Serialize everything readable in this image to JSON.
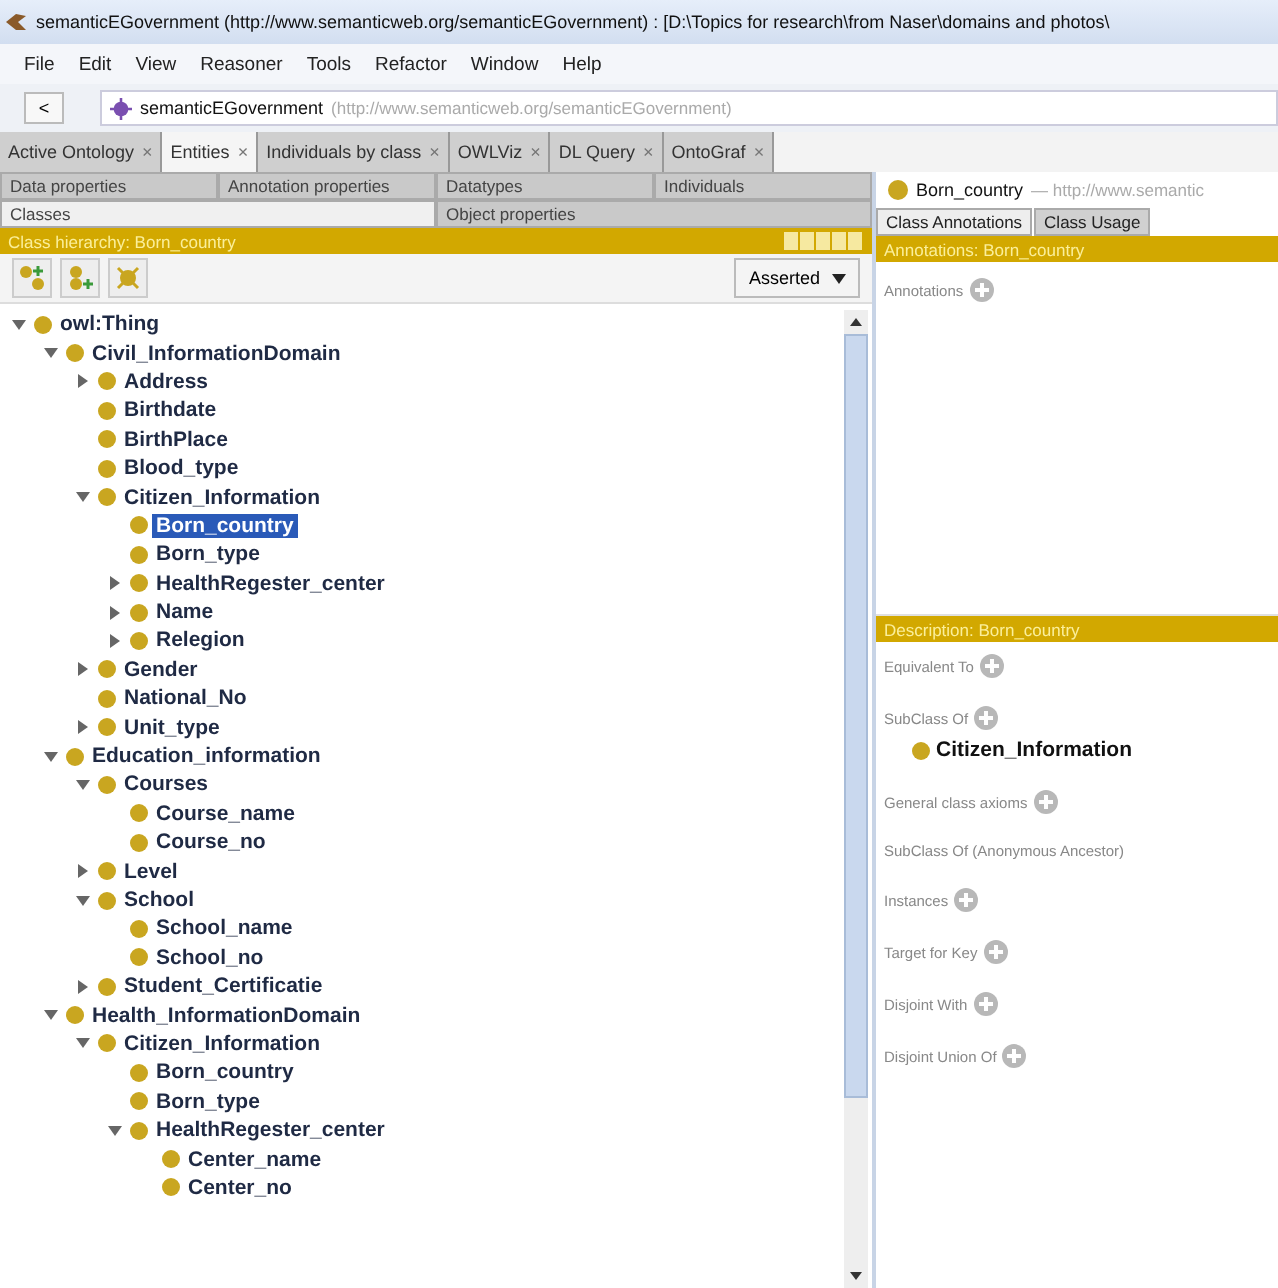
{
  "window": {
    "title": "semanticEGovernment (http://www.semanticweb.org/semanticEGovernment) : [D:\\Topics for research\\from Naser\\domains  and photos\\"
  },
  "menu": [
    "File",
    "Edit",
    "View",
    "Reasoner",
    "Tools",
    "Refactor",
    "Window",
    "Help"
  ],
  "address": {
    "back": "<",
    "name": "semanticEGovernment",
    "iri": "(http://www.semanticweb.org/semanticEGovernment)"
  },
  "tabs": [
    {
      "label": "Active Ontology",
      "close": "×",
      "selected": false
    },
    {
      "label": "Entities",
      "close": "×",
      "selected": true
    },
    {
      "label": "Individuals by class",
      "close": "×",
      "selected": false
    },
    {
      "label": "OWLViz",
      "close": "×",
      "selected": false
    },
    {
      "label": "DL Query",
      "close": "×",
      "selected": false
    },
    {
      "label": "OntoGraf",
      "close": "×",
      "selected": false
    }
  ],
  "entity_tabs": [
    [
      {
        "label": "Data properties",
        "selected": false
      },
      {
        "label": "Annotation properties",
        "selected": false
      },
      {
        "label": "Datatypes",
        "selected": false
      },
      {
        "label": "Individuals",
        "selected": false
      }
    ],
    [
      {
        "label": "Classes",
        "selected": true
      },
      {
        "label": "Object properties",
        "selected": false
      }
    ]
  ],
  "hierarchy": {
    "header": "Class hierarchy: Born_country",
    "mode": "Asserted",
    "tree": [
      {
        "label": "owl:Thing",
        "expanded": true,
        "selected": false,
        "children": [
          {
            "label": "Civil_InformationDomain",
            "expanded": true,
            "selected": false,
            "children": [
              {
                "label": "Address",
                "expanded": false,
                "selected": false
              },
              {
                "label": "Birthdate",
                "selected": false
              },
              {
                "label": "BirthPlace",
                "selected": false
              },
              {
                "label": "Blood_type",
                "selected": false
              },
              {
                "label": "Citizen_Information",
                "expanded": true,
                "selected": false,
                "children": [
                  {
                    "label": "Born_country",
                    "selected": true
                  },
                  {
                    "label": "Born_type",
                    "selected": false
                  },
                  {
                    "label": "HealthRegester_center",
                    "expanded": false,
                    "selected": false
                  },
                  {
                    "label": "Name",
                    "expanded": false,
                    "selected": false
                  },
                  {
                    "label": "Relegion",
                    "expanded": false,
                    "selected": false
                  }
                ]
              },
              {
                "label": "Gender",
                "expanded": false,
                "selected": false
              },
              {
                "label": "National_No",
                "selected": false
              },
              {
                "label": "Unit_type",
                "expanded": false,
                "selected": false
              }
            ]
          },
          {
            "label": "Education_information",
            "expanded": true,
            "selected": false,
            "children": [
              {
                "label": "Courses",
                "expanded": true,
                "selected": false,
                "children": [
                  {
                    "label": "Course_name",
                    "selected": false
                  },
                  {
                    "label": "Course_no",
                    "selected": false
                  }
                ]
              },
              {
                "label": "Level",
                "expanded": false,
                "selected": false
              },
              {
                "label": "School",
                "expanded": true,
                "selected": false,
                "children": [
                  {
                    "label": "School_name",
                    "selected": false
                  },
                  {
                    "label": "School_no",
                    "selected": false
                  }
                ]
              },
              {
                "label": "Student_Certificatie",
                "expanded": false,
                "selected": false
              }
            ]
          },
          {
            "label": "Health_InformationDomain",
            "expanded": true,
            "selected": false,
            "children": [
              {
                "label": "Citizen_Information",
                "expanded": true,
                "selected": false,
                "children": [
                  {
                    "label": "Born_country",
                    "selected": false
                  },
                  {
                    "label": "Born_type",
                    "selected": false
                  },
                  {
                    "label": "HealthRegester_center",
                    "expanded": true,
                    "selected": false,
                    "children": [
                      {
                        "label": "Center_name",
                        "selected": false
                      },
                      {
                        "label": "Center_no",
                        "selected": false
                      }
                    ]
                  }
                ]
              }
            ]
          }
        ]
      }
    ]
  },
  "entity": {
    "name": "Born_country",
    "iri": "— http://www.semantic",
    "tabs": [
      {
        "label": "Class Annotations",
        "selected": true
      },
      {
        "label": "Class Usage",
        "selected": false
      }
    ],
    "annotations_header": "Annotations: Born_country",
    "annotations_label": "Annotations",
    "description_header": "Description: Born_country",
    "sections": [
      {
        "label": "Equivalent To",
        "addable": true
      },
      {
        "label": "SubClass Of",
        "addable": true,
        "items": [
          "Citizen_Information"
        ]
      },
      {
        "label": "General class axioms",
        "addable": true
      },
      {
        "label": "SubClass Of (Anonymous Ancestor)",
        "addable": false
      },
      {
        "label": "Instances",
        "addable": true
      },
      {
        "label": "Target for Key",
        "addable": true
      },
      {
        "label": "Disjoint With",
        "addable": true
      },
      {
        "label": "Disjoint Union Of",
        "addable": true
      }
    ]
  }
}
